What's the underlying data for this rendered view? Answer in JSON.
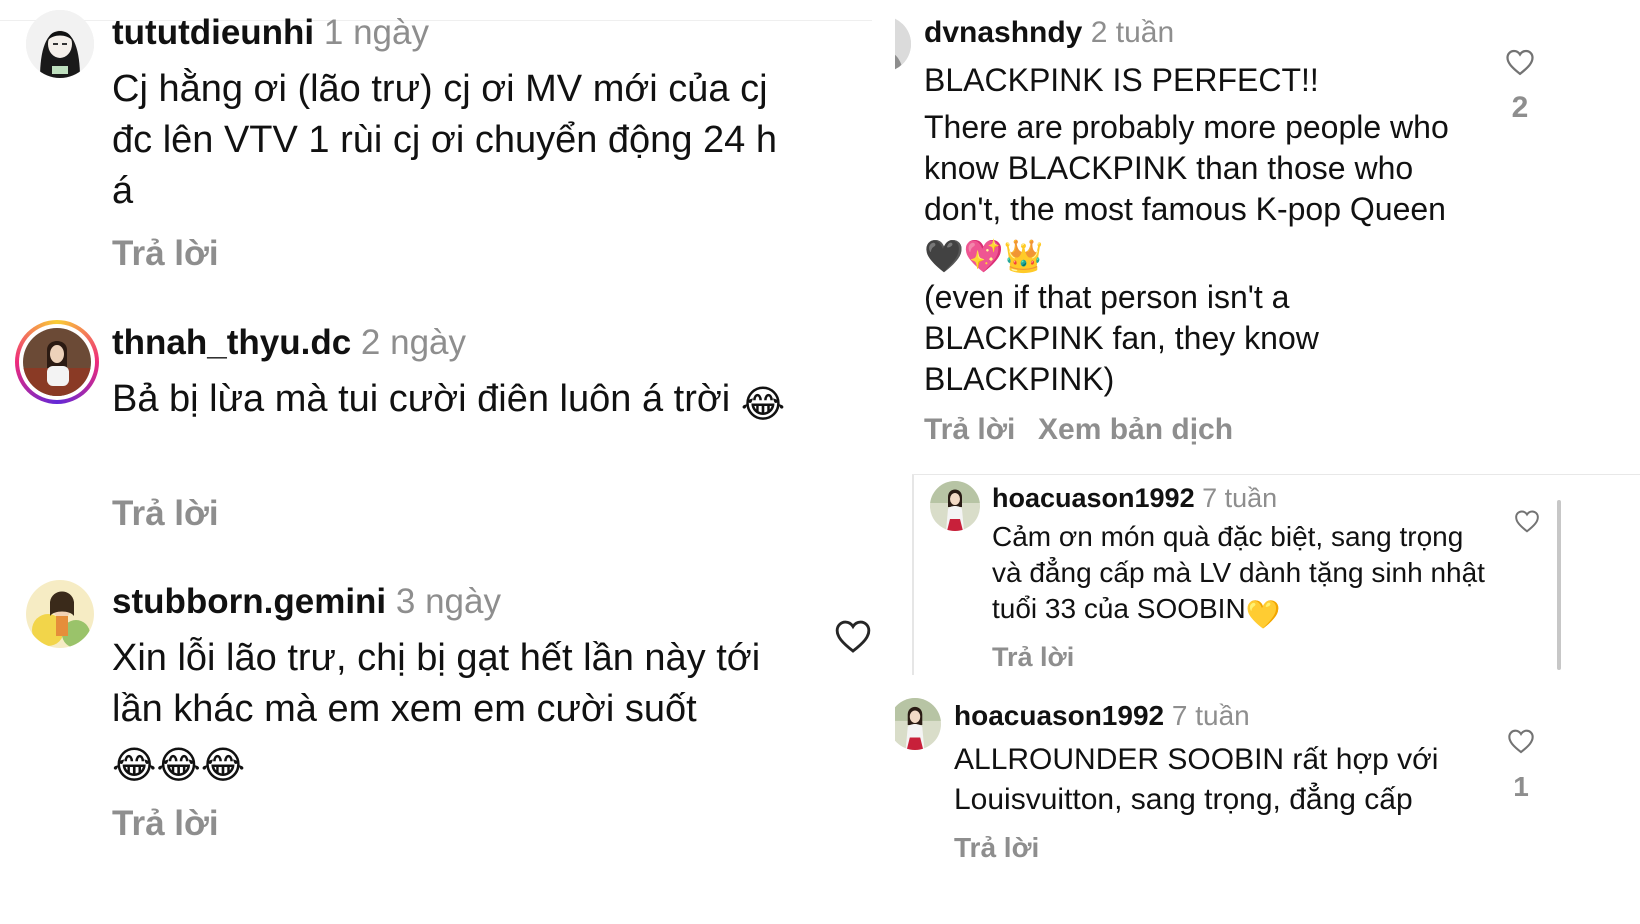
{
  "left": {
    "comments": [
      {
        "username": "tututdieunhi",
        "time": "1 ngày",
        "text": "Cj hằng ơi (lão trư) cj ơi MV mới của cj đc lên VTV 1 rùi cj ơi chuyển động 24 h á",
        "reply": "Trả lời"
      },
      {
        "username": "thnah_thyu.dc",
        "time": "2 ngày",
        "text": "Bả bị lừa mà tui cười điên luôn á trời",
        "emojis": "😂",
        "reply": "Trả lời"
      },
      {
        "username": "stubborn.gemini",
        "time": "3 ngày",
        "text": "Xin lỗi lão trư, chị bị gạt hết lần này tới lần khác mà em xem em cười suốt",
        "emojis": "😂😂😂",
        "reply": "Trả lời"
      }
    ]
  },
  "right": {
    "main_comment": {
      "username": "dvnashndy",
      "time": "2 tuần",
      "text1": "BLACKPINK IS PERFECT!!",
      "text2": "There are probably more people who know BLACKPINK than those who don't, the most famous K-pop Queen",
      "text2_emojis": "🖤💖👑",
      "text3": "(even if that person isn't a BLACKPINK fan, they know BLACKPINK)",
      "reply": "Trả lời",
      "translate": "Xem bản dịch",
      "likes": "2"
    },
    "reply_comment": {
      "username": "hoacuason1992",
      "time": "7 tuần",
      "text": "Cảm ơn món quà đặc biệt, sang trọng và đẳng cấp mà LV dành tặng sinh nhật tuổi 33 của SOOBIN",
      "emoji": "💛",
      "reply": "Trả lời"
    },
    "bottom_comment": {
      "username": "hoacuason1992",
      "time": "7 tuần",
      "text": "ALLROUNDER SOOBIN rất hợp với Louisvuitton, sang trọng, đẳng cấp",
      "reply": "Trả lời",
      "likes": "1"
    }
  },
  "colors": {
    "text": "#111111",
    "secondary": "#8e8e8e",
    "divider": "#e8e8e8"
  }
}
